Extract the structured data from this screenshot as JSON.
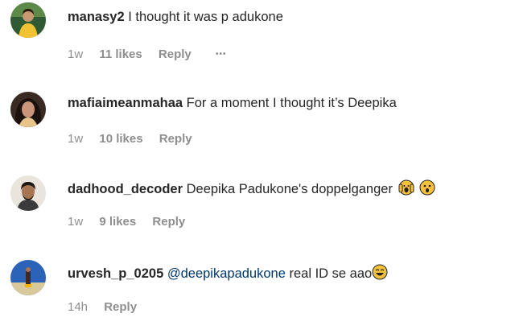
{
  "comments": [
    {
      "username": "manasy2",
      "text": "I thought it was p adukone",
      "time": "1w",
      "likes": "11 likes",
      "reply": "Reply",
      "more": "•••"
    },
    {
      "username": "mafiaimeanmahaa",
      "text": "For a moment I thought it’s Deepika",
      "time": "1w",
      "likes": "10 likes",
      "reply": "Reply"
    },
    {
      "username": "dadhood_decoder",
      "text": "Deepika Padukone's doppelganger",
      "emojis": [
        "screaming-in-fear-emoji",
        "astonished-face-emoji"
      ],
      "time": "1w",
      "likes": "9 likes",
      "reply": "Reply"
    },
    {
      "username": "urvesh_p_0205",
      "mention": "@deepikapadukone",
      "text": "real ID se aao",
      "emojis": [
        "tears-of-joy-emoji"
      ],
      "time": "14h",
      "reply": "Reply"
    }
  ],
  "colors": {
    "text": "#262626",
    "secondary": "#8e8e8e",
    "mention": "#00376b",
    "emoji_yellow": "#f7c23a"
  }
}
